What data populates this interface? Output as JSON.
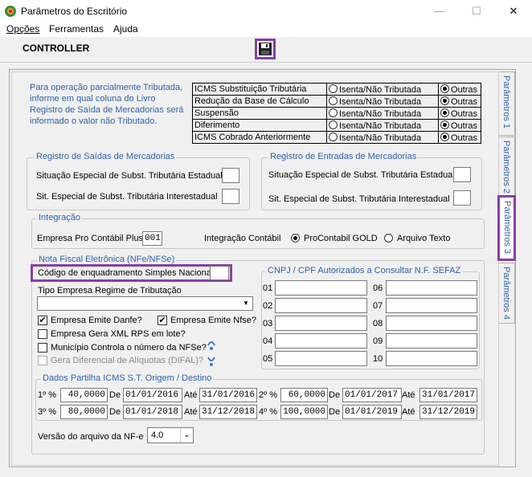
{
  "window": {
    "title": "Parâmetros do Escritório",
    "minimize": "—",
    "maximize": "☐",
    "close": "✕"
  },
  "menu": {
    "opcoes": "Opções",
    "ferramentas": "Ferramentas",
    "ajuda": "Ajuda"
  },
  "header": {
    "label": "CONTROLLER"
  },
  "icms_info": "Para operação parcialmente Tributada, informe em qual coluna do Livro Registro de Saída de Mercadorias será informado o valor não Tributado.",
  "icms_table": [
    {
      "label": "ICMS Substituição Tributária",
      "opt1": "Isenta/Não Tributada",
      "opt2": "Outras",
      "selected": "Outras"
    },
    {
      "label": "Redução da Base de Cálculo",
      "opt1": "Isenta/Não Tributada",
      "opt2": "Outras",
      "selected": "Outras"
    },
    {
      "label": "Suspensão",
      "opt1": "Isenta/Não Tributada",
      "opt2": "Outras",
      "selected": "Outras"
    },
    {
      "label": "Diferimento",
      "opt1": "Isenta/Não Tributada",
      "opt2": "Outras",
      "selected": "Outras"
    },
    {
      "label": "ICMS Cobrado Anteriormente",
      "opt1": "Isenta/Não Tributada",
      "opt2": "Outras",
      "selected": "Outras"
    }
  ],
  "saidas": {
    "legend": "Registro de Saídas de Mercadorias",
    "estadual": "Situação Especial de Subst. Tributária Estadual",
    "interestadual": "Sit. Especial de Subst. Tributária Interestadual"
  },
  "entradas": {
    "legend": "Registro de Entradas de Mercadorias",
    "estadual": "Situação Especial de Subst. Tributária Estadual",
    "interestadual": "Sit. Especial de Subst. Tributária Interestadual"
  },
  "integracao": {
    "legend": "Integração",
    "empresa_label": "Empresa Pro Contábil Plus",
    "empresa_value": "001",
    "contabil_label": "Integração Contábil",
    "opt1": "ProContabil GOLD",
    "opt2": "Arquivo Texto",
    "selected": "ProContabil GOLD"
  },
  "nfe": {
    "legend": "Nota Fiscal Eletrônica (NFe/NFSe)",
    "codigo_label": "Código de enquadramento Simples Nacional",
    "tipo_label": "Tipo Empresa Regime de Tributação",
    "tipo_value": "",
    "checks": [
      {
        "label": "Empresa Emite Danfe?",
        "checked": true,
        "disabled": false
      },
      {
        "label": "Empresa Emite Nfse?",
        "checked": true,
        "disabled": false
      },
      {
        "label": "Empresa Gera XML RPS em lote?",
        "checked": false,
        "disabled": false
      },
      {
        "label": "Município Controla o número da NFSe?",
        "checked": false,
        "disabled": false
      },
      {
        "label": "Gera Diferencial de Alíquotas (DIFAL)?",
        "checked": false,
        "disabled": true
      }
    ]
  },
  "cnpj": {
    "legend": "CNPJ / CPF Autorizados a Consultar N.F. SEFAZ",
    "left": [
      "01",
      "02",
      "03",
      "04",
      "05"
    ],
    "right": [
      "06",
      "07",
      "08",
      "09",
      "10"
    ]
  },
  "partilha": {
    "legend": "Dados Partilha ICMS S.T. Origem / Destino",
    "de": "De",
    "ate": "Até",
    "rows": [
      {
        "label": "1º %",
        "pct": "40,0000",
        "de": "01/01/2016",
        "ate": "31/01/2016"
      },
      {
        "label": "2º %",
        "pct": "60,0000",
        "de": "01/01/2017",
        "ate": "31/01/2017"
      },
      {
        "label": "3º %",
        "pct": "80,0000",
        "de": "01/01/2018",
        "ate": "31/12/2018"
      },
      {
        "label": "4º %",
        "pct": "100,0000",
        "de": "01/01/2019",
        "ate": "31/12/2019"
      }
    ]
  },
  "versao": {
    "label": "Versão do arquivo da NF-e",
    "value": "4.0"
  },
  "tabs": [
    "Parâmetros 1",
    "Parâmetros 2",
    "Parâmetros 3",
    "Parâmetros 4"
  ],
  "colors": {
    "accent": "#8a3ea0",
    "label_blue": "#2f62a8"
  }
}
